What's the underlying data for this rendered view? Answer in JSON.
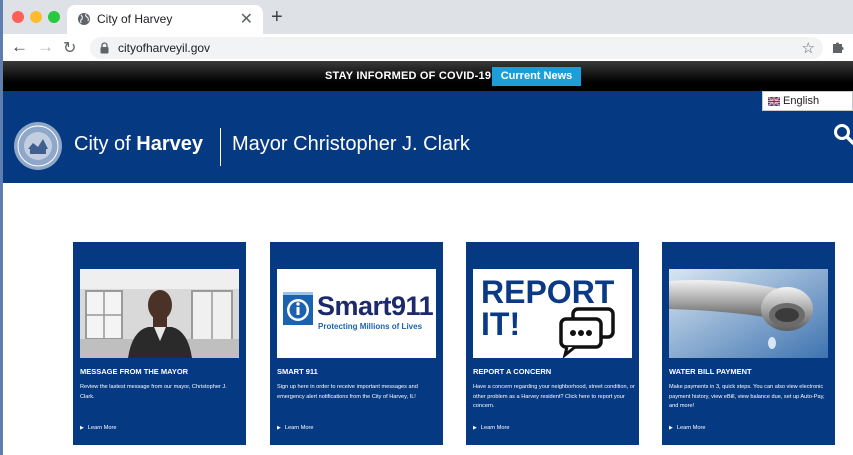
{
  "browser": {
    "tab_title": "City of Harvey",
    "tab_close": "✕",
    "new_tab": "+",
    "back": "←",
    "forward": "→",
    "reload": "↻",
    "url": "cityofharveyil.gov",
    "bookmark": "☆"
  },
  "covid_banner": {
    "text": "STAY INFORMED OF COVID-19",
    "button": "Current News",
    "button_color": "#1c9fd8"
  },
  "header": {
    "brand_prefix": "City of ",
    "brand_bold": "Harvey",
    "mayor": "Mayor Christopher J. Clark",
    "language": "English",
    "background": "#053a83"
  },
  "cards": [
    {
      "title": "MESSAGE FROM THE MAYOR",
      "description": "Review the lastest message from our mayor, Christopher J. Clark.",
      "link": "Learn More",
      "image": "mayor-photo"
    },
    {
      "title": "SMART 911",
      "description": "Sign up here in order to receive important messages and emergency alert notifications from the City of Harvey, IL!",
      "link": "Learn More",
      "image": "smart911-logo",
      "image_brand": "Smart911",
      "image_tagline": "Protecting Millions of Lives"
    },
    {
      "title": "REPORT A CONCERN",
      "description": "Have a concern regarding your neighborhood, street condition, or other problem as a Harvey resident? Click here to report your concern.",
      "link": "Learn More",
      "image": "report-it-graphic",
      "image_line1": "REPORT",
      "image_line2": "IT!"
    },
    {
      "title": "WATER BILL PAYMENT",
      "description": "Make payments in 3, quick steps. You can also view electronic payment history, view eBill, view balance due, set up Auto-Pay, and more!",
      "link": "Learn More",
      "image": "faucet-photo"
    }
  ]
}
